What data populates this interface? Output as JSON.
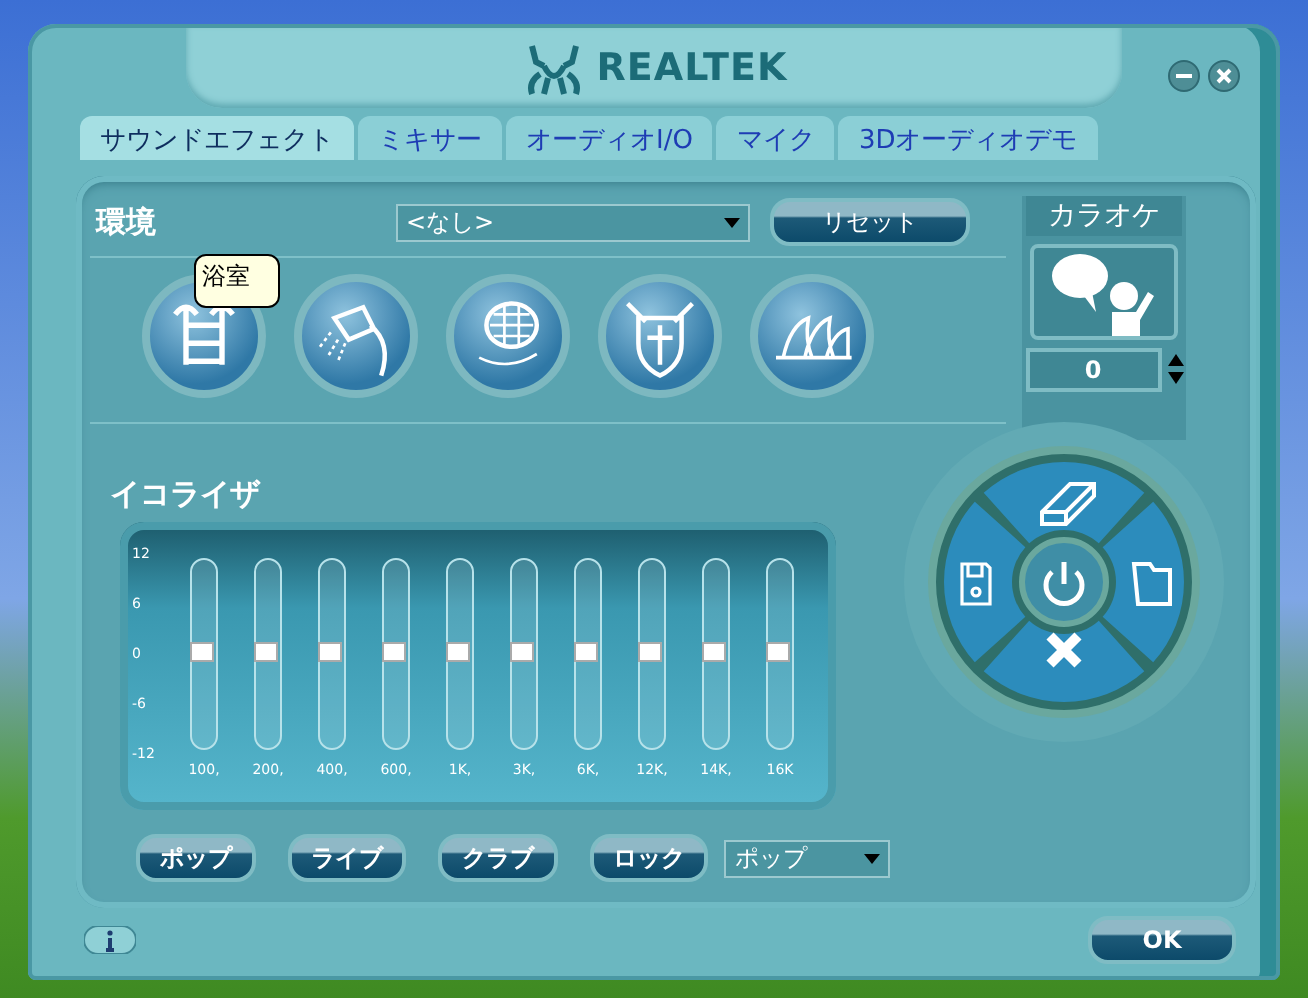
{
  "window": {
    "logo": "REALTEK"
  },
  "tabs": [
    {
      "label": "サウンドエフェクト",
      "selected": true
    },
    {
      "label": "ミキサー",
      "selected": false
    },
    {
      "label": "オーディオI/O",
      "selected": false
    },
    {
      "label": "マイク",
      "selected": false
    },
    {
      "label": "3Dオーディオデモ",
      "selected": false
    }
  ],
  "environment": {
    "label": "環境",
    "dropdown": {
      "value": "<なし>"
    },
    "reset_button": "リセット",
    "tooltip": "浴室",
    "presets": [
      {
        "kind": "ladder"
      },
      {
        "kind": "shower"
      },
      {
        "kind": "grate"
      },
      {
        "kind": "shield"
      },
      {
        "kind": "opera"
      }
    ]
  },
  "karaoke": {
    "title": "カラオケ",
    "value": "0"
  },
  "equalizer": {
    "label": "イコライザ",
    "scale": [
      "12",
      "6",
      "0",
      "-6",
      "-12"
    ],
    "bands": [
      {
        "label": "100,",
        "level": 0.5
      },
      {
        "label": "200,",
        "level": 0.5
      },
      {
        "label": "400,",
        "level": 0.5
      },
      {
        "label": "600,",
        "level": 0.5
      },
      {
        "label": "1K,",
        "level": 0.5
      },
      {
        "label": "3K,",
        "level": 0.5
      },
      {
        "label": "6K,",
        "level": 0.5
      },
      {
        "label": "12K,",
        "level": 0.5
      },
      {
        "label": "14K,",
        "level": 0.5
      },
      {
        "label": "16K",
        "level": 0.5
      }
    ]
  },
  "preset_buttons": [
    "ポップ",
    "ライブ",
    "クラブ",
    "ロック"
  ],
  "preset_dropdown": {
    "value": "ポップ"
  },
  "ok_button": "OK"
}
